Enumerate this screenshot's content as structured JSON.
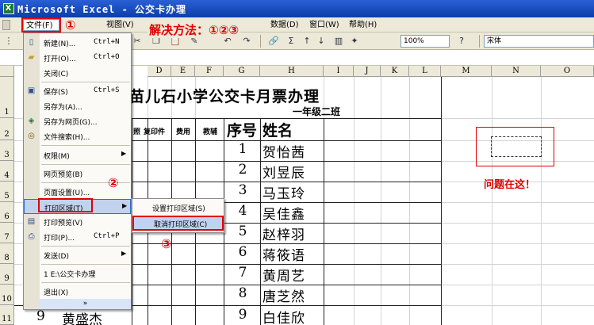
{
  "window": {
    "title": "Microsoft Excel - 公交卡办理"
  },
  "menubar": {
    "items": [
      "文件(F)",
      "视图(V)",
      "数据(D)",
      "窗口(W)",
      "帮助(H)"
    ]
  },
  "toolbar": {
    "zoom": "100%",
    "font": "宋体"
  },
  "annotations": {
    "step1": "①",
    "solution": "解决方法：①②③",
    "step2": "②",
    "step3": "③",
    "problem": "问题在这！"
  },
  "file_menu": {
    "items": [
      {
        "label": "新建(N)...",
        "shortcut": "Ctrl+N",
        "icon": "new-document-icon"
      },
      {
        "label": "打开(O)...",
        "shortcut": "Ctrl+O",
        "icon": "open-folder-icon"
      },
      {
        "label": "关闭(C)",
        "shortcut": "",
        "icon": ""
      },
      {
        "label": "保存(S)",
        "shortcut": "Ctrl+S",
        "icon": "save-icon"
      },
      {
        "label": "另存为(A)...",
        "shortcut": "",
        "icon": ""
      },
      {
        "label": "另存为网页(G)...",
        "shortcut": "",
        "icon": "web-page-icon"
      },
      {
        "label": "文件搜索(H)...",
        "shortcut": "",
        "icon": "file-search-icon"
      },
      {
        "label": "权限(M)",
        "shortcut": "",
        "icon": ""
      },
      {
        "label": "网页预览(B)",
        "shortcut": "",
        "icon": ""
      },
      {
        "label": "页面设置(U)...",
        "shortcut": "",
        "icon": ""
      },
      {
        "label": "打印区域(T)",
        "shortcut": "",
        "icon": ""
      },
      {
        "label": "打印预览(V)",
        "shortcut": "",
        "icon": "print-preview-icon"
      },
      {
        "label": "打印(P)...",
        "shortcut": "Ctrl+P",
        "icon": "print-icon"
      },
      {
        "label": "发送(D)",
        "shortcut": "",
        "icon": ""
      },
      {
        "label": "1 E:\\公交卡办理",
        "shortcut": "",
        "icon": ""
      },
      {
        "label": "退出(X)",
        "shortcut": "",
        "icon": ""
      }
    ],
    "expand": "»"
  },
  "print_area_submenu": {
    "items": [
      "设置打印区域(S)",
      "取消打印区域(C)"
    ]
  },
  "sheet": {
    "columns": [
      "D",
      "E",
      "F",
      "G",
      "H",
      "I",
      "J",
      "K",
      "L",
      "M",
      "N",
      "O"
    ],
    "rows": [
      "1",
      "2",
      "3",
      "4",
      "5",
      "6",
      "7",
      "8",
      "9",
      "10",
      "11"
    ],
    "title": "苗儿石小学公交卡月票办理",
    "subtitle": "一年级二班",
    "small_headers": [
      "照",
      "复印件",
      "费用",
      "教辅"
    ],
    "seq_header": "序号",
    "name_header": "姓名",
    "entries": [
      {
        "no": "1",
        "name": "贺怡茜"
      },
      {
        "no": "2",
        "name": "刘昱辰"
      },
      {
        "no": "3",
        "name": "马玉玲"
      },
      {
        "no": "4",
        "name": "吴佳鑫"
      },
      {
        "no": "5",
        "name": "赵梓羽"
      },
      {
        "no": "6",
        "name": "蒋筱语"
      },
      {
        "no": "7",
        "name": "黄周艺"
      },
      {
        "no": "8",
        "name": "唐芝然"
      },
      {
        "no": "9",
        "name": "白佳欣"
      }
    ],
    "bottom_left_no": "9",
    "bottom_left_name": "黄盛杰"
  }
}
